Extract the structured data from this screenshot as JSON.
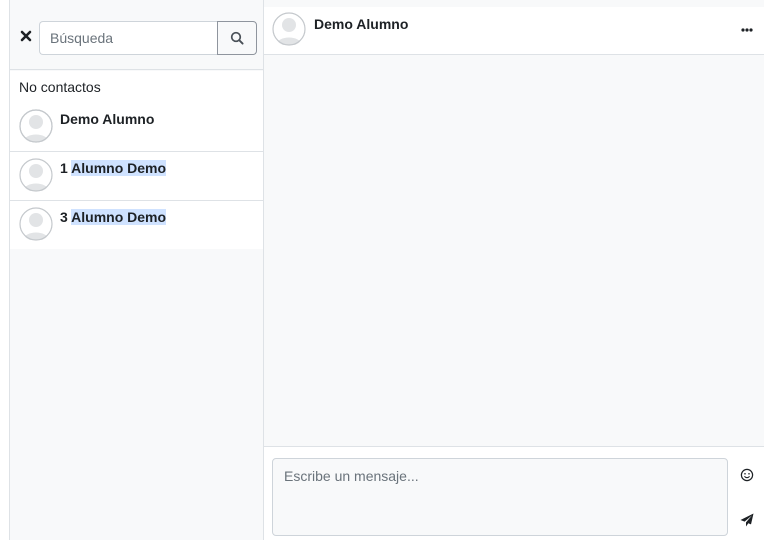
{
  "search": {
    "placeholder": "Búsqueda",
    "close_icon": "close-icon",
    "search_icon": "search-icon"
  },
  "results": {
    "section_title": "No contactos",
    "contacts": [
      {
        "prefix": "",
        "name": "Demo Alumno",
        "highlight": ""
      },
      {
        "prefix": "1 ",
        "name": "",
        "highlight": "Alumno Demo"
      },
      {
        "prefix": "3 ",
        "name": "",
        "highlight": "Alumno Demo"
      }
    ]
  },
  "conversation": {
    "name": "Demo Alumno",
    "menu_icon": "more-options-icon"
  },
  "composer": {
    "placeholder": "Escribe un mensaje...",
    "emoji_icon": "emoji-icon",
    "send_icon": "send-icon"
  },
  "colors": {
    "highlight": "#cfe2ff",
    "panel_bg": "#f8f9fa",
    "border": "#dee2e6"
  }
}
